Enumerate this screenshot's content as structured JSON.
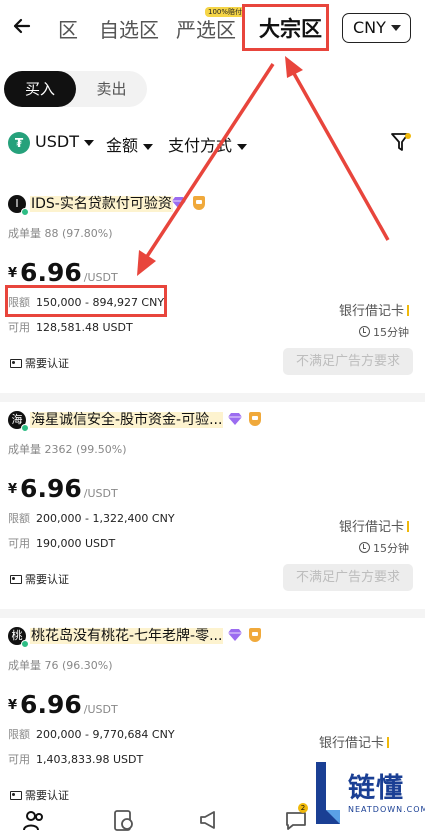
{
  "header": {
    "tabs": [
      {
        "label": "区"
      },
      {
        "label": "自选区"
      },
      {
        "label": "严选区",
        "badge": "100%赔付"
      },
      {
        "label": "大宗区",
        "active": true
      }
    ],
    "currency": "CNY"
  },
  "segment": {
    "buy": "买入",
    "sell": "卖出"
  },
  "filters": {
    "coin": "USDT",
    "coin_icon": "tether-icon",
    "amount": "金额",
    "payment": "支付方式"
  },
  "ads": [
    {
      "avatar": "I",
      "merchant": "IDS-实名贷款付可验资",
      "orders_label": "成单量",
      "orders": "88 (97.80%)",
      "currency_symbol": "¥",
      "price": "6.96",
      "price_unit": "/USDT",
      "limit_label": "限额",
      "limit": "150,000 - 894,927 CNY",
      "available_label": "可用",
      "available": "128,581.48 USDT",
      "payment": "银行借记卡",
      "time": "15分钟",
      "verify": "需要认证",
      "action": "不满足广告方要求"
    },
    {
      "avatar": "海",
      "merchant": "海星诚信安全-股市资金-可验...",
      "orders_label": "成单量",
      "orders": "2362 (99.50%)",
      "currency_symbol": "¥",
      "price": "6.96",
      "price_unit": "/USDT",
      "limit_label": "限额",
      "limit": "200,000 - 1,322,400 CNY",
      "available_label": "可用",
      "available": "190,000 USDT",
      "payment": "银行借记卡",
      "time": "15分钟",
      "verify": "需要认证",
      "action": "不满足广告方要求"
    },
    {
      "avatar": "桃",
      "merchant": "桃花岛没有桃花-七年老牌-零...",
      "orders_label": "成单量",
      "orders": "76 (96.30%)",
      "currency_symbol": "¥",
      "price": "6.96",
      "price_unit": "/USDT",
      "limit_label": "限额",
      "limit": "200,000 - 9,770,684 CNY",
      "available_label": "可用",
      "available": "1,403,833.98 USDT",
      "payment": "银行借记卡",
      "verify": "需要认证"
    }
  ],
  "bottom_nav": [
    {
      "icon": "users-icon"
    },
    {
      "icon": "orders-clock-icon"
    },
    {
      "icon": "megaphone-icon"
    },
    {
      "icon": "chat-icon",
      "badge": "2"
    }
  ],
  "watermark": {
    "title": "链懂",
    "subtitle": "NEATDOWN.COM"
  },
  "colors": {
    "annotation_red": "#e8453c",
    "online_green": "#2ebd85",
    "tether_green": "#26a17b",
    "watermark_blue": "#1a3f94"
  }
}
